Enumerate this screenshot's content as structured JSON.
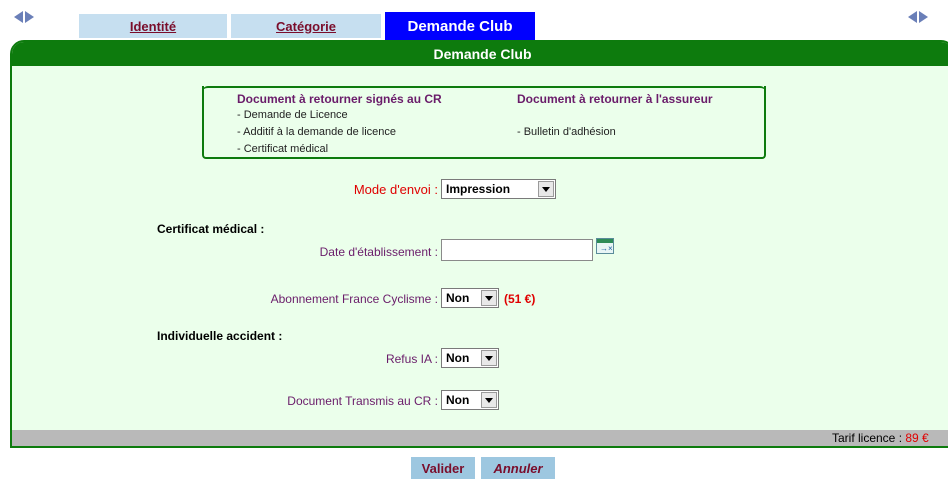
{
  "tabs": [
    {
      "label": "Identité",
      "active": false
    },
    {
      "label": "Catégorie",
      "active": false
    },
    {
      "label": "Demande Club",
      "active": true
    }
  ],
  "panel": {
    "title": "Demande Club"
  },
  "documents": {
    "cr_heading": "Document à retourner signés au CR",
    "cr_items": [
      "- Demande de Licence",
      "- Additif à la demande de licence",
      "- Certificat médical"
    ],
    "assureur_heading": "Document à retourner à l'assureur",
    "assureur_items": [
      "- Bulletin d'adhésion"
    ]
  },
  "form": {
    "mode_envoi": {
      "label": "Mode d'envoi :",
      "value": "Impression"
    },
    "certificat_section": "Certificat médical :",
    "date_etablissement": {
      "label": "Date d'établissement :",
      "value": ""
    },
    "abonnement": {
      "label": "Abonnement France Cyclisme :",
      "value": "Non",
      "price": "(51 €)"
    },
    "ia_section": "Individuelle accident :",
    "refus_ia": {
      "label": "Refus IA :",
      "value": "Non"
    },
    "document_transmis": {
      "label": "Document Transmis au CR :",
      "value": "Non"
    }
  },
  "footer": {
    "tarif_label": "Tarif licence : ",
    "tarif_value": "89 €"
  },
  "actions": {
    "valider": "Valider",
    "annuler": "Annuler"
  },
  "colors": {
    "accent_green": "#0d7b0d",
    "tab_active": "#0000ff",
    "label_purple": "#6a1c6a",
    "price_red": "#e00000"
  }
}
